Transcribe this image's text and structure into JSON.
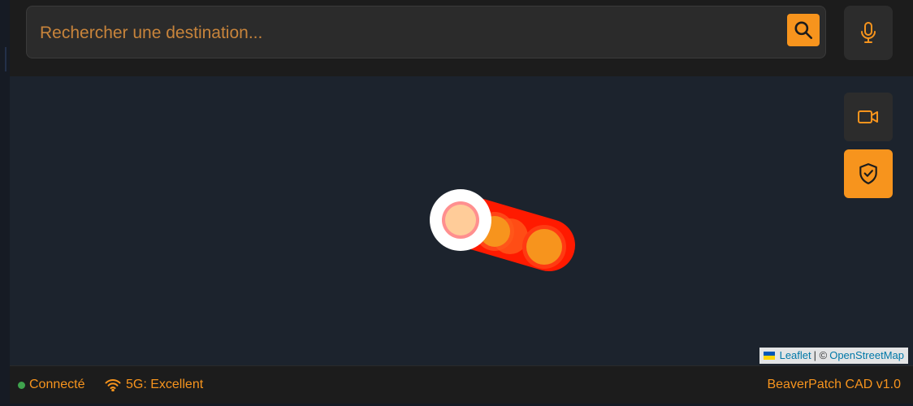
{
  "search": {
    "placeholder": "Rechercher une destination..."
  },
  "icons": {
    "search": "search-icon",
    "microphone": "microphone-icon",
    "video": "video-camera-icon",
    "shield": "shield-check-icon",
    "wifi": "wifi-icon",
    "flag": "ukraine-flag-icon"
  },
  "map": {
    "attribution": {
      "leaflet": "Leaflet",
      "separator": "| ©",
      "osm": "OpenStreetMap"
    }
  },
  "status": {
    "connection": "Connecté",
    "network": "5G: Excellent",
    "version": "BeaverPatch CAD v1.0"
  },
  "colors": {
    "accent": "#f7941d",
    "route": "#ff1a00",
    "connected": "#3fa34d",
    "map_bg": "#1c232d"
  }
}
